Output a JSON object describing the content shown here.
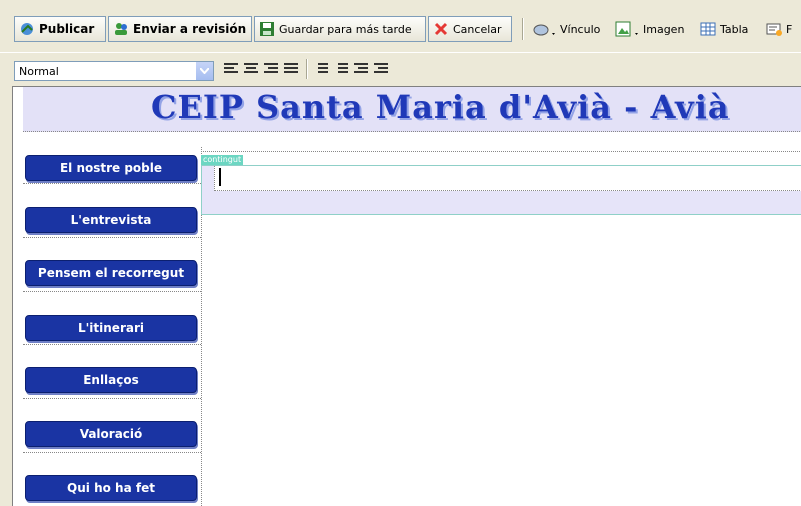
{
  "toolbar": {
    "publish": "Publicar",
    "send_review": "Enviar a revisión",
    "save_later": "Guardar para más tarde",
    "cancel": "Cancelar",
    "link": "Vínculo",
    "image": "Imagen",
    "table": "Tabla",
    "more": "F"
  },
  "format": {
    "style_value": "Normal"
  },
  "page": {
    "banner_title": "CEIP Santa Maria d'Avià - Avià",
    "content_region_label": "contingut",
    "nav": [
      {
        "label": "El nostre poble"
      },
      {
        "label": "L'entrevista"
      },
      {
        "label": "Pensem el recorregut"
      },
      {
        "label": "L'itinerari"
      },
      {
        "label": "Enllaços"
      },
      {
        "label": "Valoració"
      },
      {
        "label": "Qui ho ha fet"
      }
    ]
  },
  "colors": {
    "nav_button": "#1a34a3",
    "banner_bg": "#e3e1f7",
    "title": "#2039b8",
    "content_tag": "#6cd6c2"
  }
}
